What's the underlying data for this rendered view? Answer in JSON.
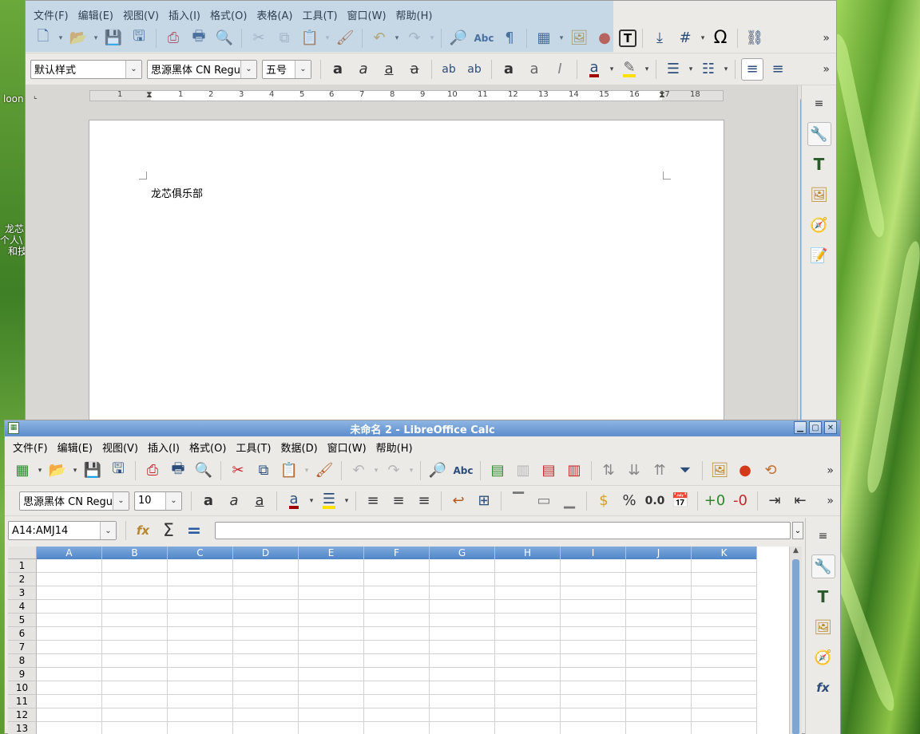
{
  "desktop": {
    "labels": [
      "loon",
      "龙芯",
      "个人\\",
      "和技"
    ]
  },
  "writer": {
    "menu": [
      "文件(F)",
      "编辑(E)",
      "视图(V)",
      "插入(I)",
      "格式(O)",
      "表格(A)",
      "工具(T)",
      "窗口(W)",
      "帮助(H)"
    ],
    "paragraph_style": "默认样式",
    "font_name": "思源黑体 CN Regul",
    "font_size": "五号",
    "ruler_ticks": [
      "1",
      "1",
      "2",
      "3",
      "4",
      "5",
      "6",
      "7",
      "8",
      "9",
      "10",
      "11",
      "12",
      "13",
      "14",
      "15",
      "16",
      "17",
      "18"
    ],
    "document_text": "龙芯俱乐部",
    "font_color": "#a00000",
    "highlight_color": "#ffe000"
  },
  "calc": {
    "title": "未命名 2 - LibreOffice Calc",
    "menu": [
      "文件(F)",
      "编辑(E)",
      "视图(V)",
      "插入(I)",
      "格式(O)",
      "工具(T)",
      "数据(D)",
      "窗口(W)",
      "帮助(H)"
    ],
    "font_name": "思源黑体 CN Regul",
    "font_size": "10",
    "name_box": "A14:AMJ14",
    "formula": "",
    "columns": [
      "A",
      "B",
      "C",
      "D",
      "E",
      "F",
      "G",
      "H",
      "I",
      "J",
      "K"
    ],
    "rows": [
      "1",
      "2",
      "3",
      "4",
      "5",
      "6",
      "7",
      "8",
      "9",
      "10",
      "11",
      "12",
      "13"
    ],
    "font_color": "#a00000",
    "highlight_color": "#ffe000"
  },
  "icons": {
    "more": "»",
    "sigma": "Σ",
    "equals": "=",
    "fx": "fx",
    "omega": "Ω",
    "pilcrow": "¶",
    "abc": "Abc",
    "percent": "%",
    "number": "0.0"
  }
}
